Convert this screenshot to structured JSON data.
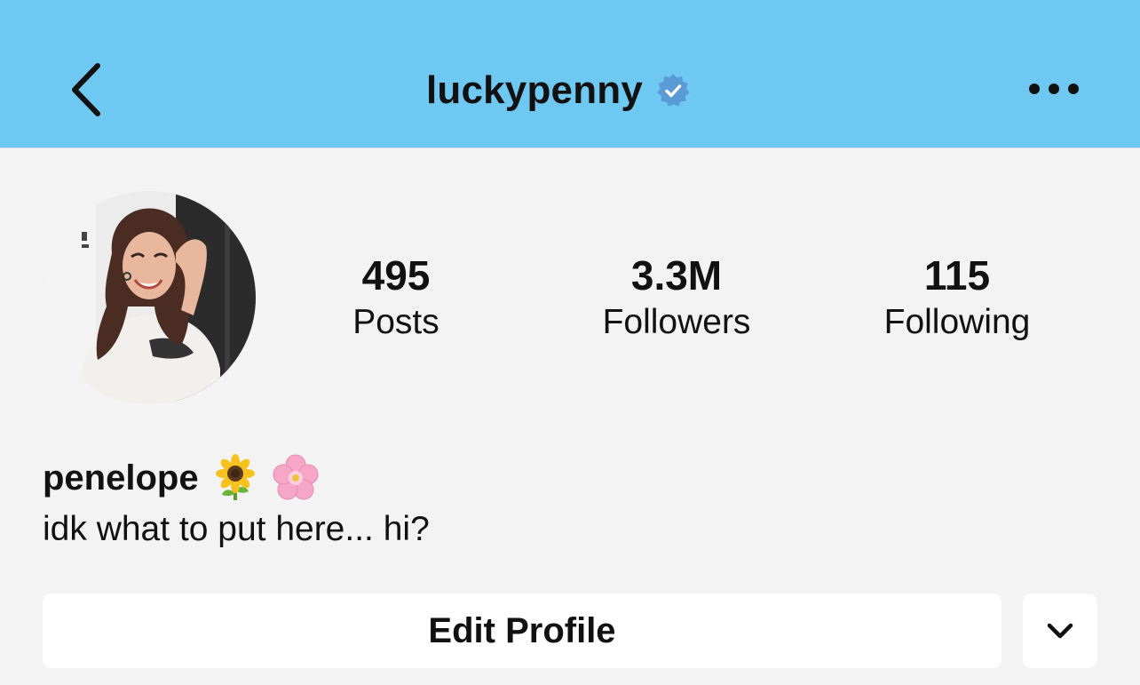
{
  "header": {
    "username": "luckypenny",
    "verified": true,
    "background_color": "#6fc8f2",
    "verified_badge_color": "#5b9bd5",
    "back_icon": "chevron-left-icon",
    "more_icon": "more-horizontal-icon"
  },
  "profile": {
    "avatar_icon": "profile-photo",
    "stats": [
      {
        "value": "495",
        "label": "Posts"
      },
      {
        "value": "3.3M",
        "label": "Followers"
      },
      {
        "value": "115",
        "label": "Following"
      }
    ],
    "display_name": "penelope",
    "display_name_emojis": [
      "sunflower-emoji",
      "cherry-blossom-emoji"
    ],
    "bio": "idk what to put here... hi?"
  },
  "actions": {
    "edit_profile_label": "Edit Profile",
    "expand_icon": "chevron-down-icon"
  }
}
